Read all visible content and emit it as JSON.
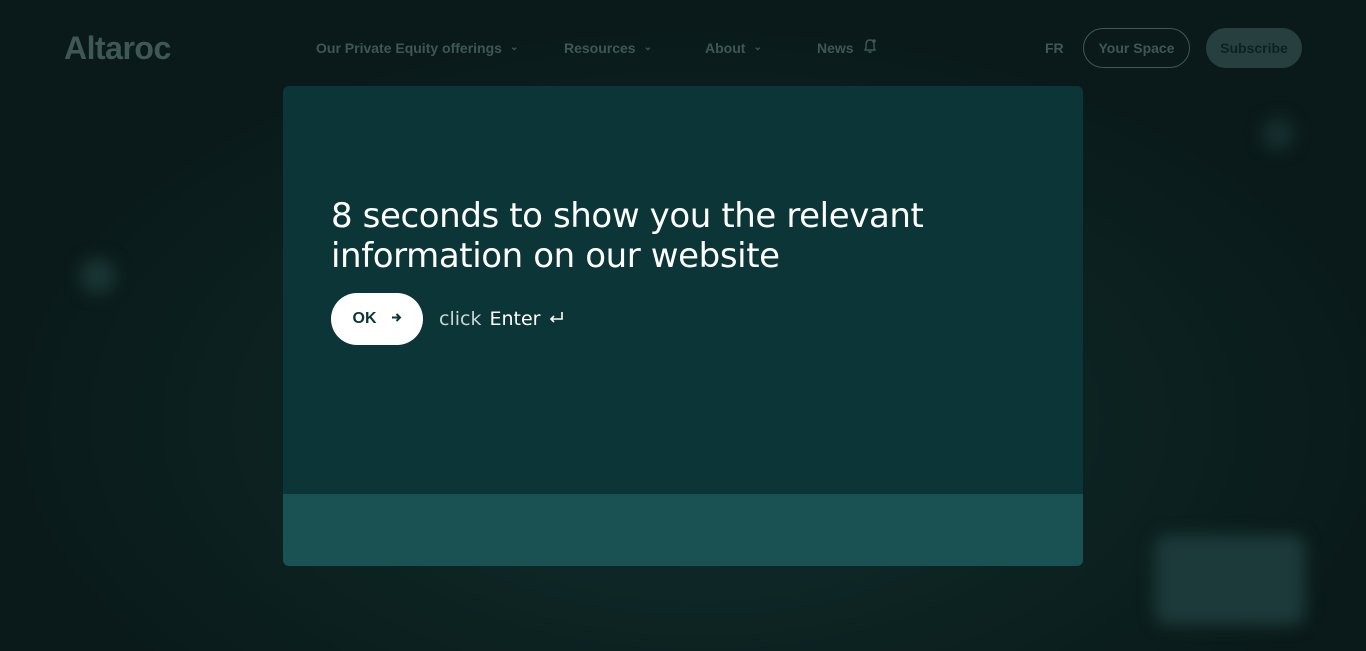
{
  "nav": {
    "logo": "Altaroc",
    "items": [
      {
        "label": "Our Private Equity offerings"
      },
      {
        "label": "Resources"
      },
      {
        "label": "About"
      },
      {
        "label": "News"
      }
    ],
    "lang": "FR",
    "your_space": "Your Space",
    "subscribe": "Subscribe"
  },
  "modal": {
    "heading": "8 seconds to show  you the relevant information on our website",
    "ok_label": "OK",
    "hint_click": "click",
    "hint_key": "Enter",
    "enter_icon": "enter-key-icon",
    "arrow_icon": "arrow-right-icon"
  },
  "colors": {
    "modal_bg": "#0b3536",
    "modal_footer": "#1a5152",
    "button_bg": "#ffffff"
  }
}
